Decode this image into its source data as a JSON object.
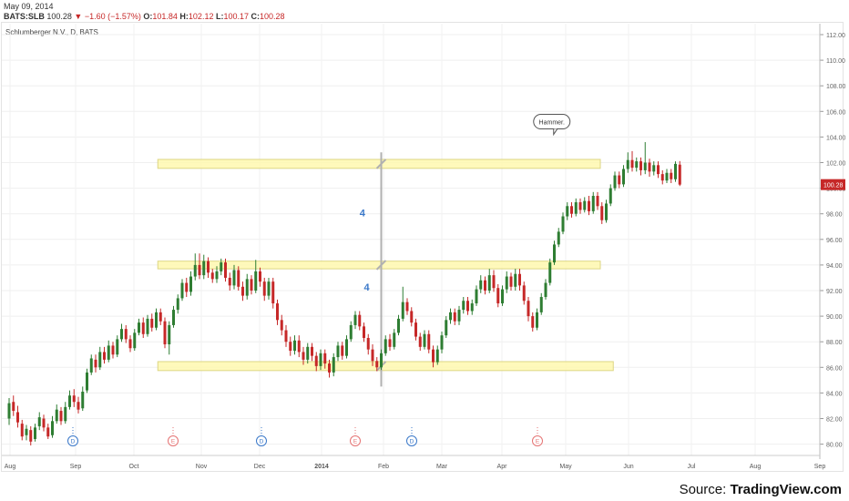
{
  "header": {
    "date": "May 09, 2014",
    "symbol": "BATS:SLB",
    "last": "100.28",
    "change": "▼ −1.60 (−1.57%)",
    "open_label": "O:",
    "open": "101.84",
    "high_label": "H:",
    "high": "102.12",
    "low_label": "L:",
    "low": "100.17",
    "close_label": "C:",
    "close": "100.28"
  },
  "instrument": "Schlumberger N.V., D, BATS",
  "price_badge": "100.28",
  "source": {
    "prefix": "Source: ",
    "brand": "TradingView.com"
  },
  "colors": {
    "up": "#2e7d32",
    "down": "#c62828",
    "zone_fill": "#fff9b0",
    "zone_stroke": "#d8d070",
    "grey_line": "#b0b0b0",
    "badge": "#c62828",
    "annot": "#3a78c9"
  },
  "chart_data": {
    "type": "candlestick",
    "title": "Schlumberger N.V., D, BATS",
    "ylim": [
      79,
      112.5
    ],
    "y_ticks": [
      "80.00",
      "82.00",
      "84.00",
      "86.00",
      "88.00",
      "90.00",
      "92.00",
      "94.00",
      "96.00",
      "98.00",
      "100.00",
      "102.00",
      "104.00",
      "106.00",
      "108.00",
      "110.00",
      "112.00"
    ],
    "x_ticks": [
      "Aug",
      "Sep",
      "Oct",
      "Nov",
      "Dec",
      "2014",
      "Feb",
      "Mar",
      "Apr",
      "May",
      "Jun",
      "Jul",
      "Aug",
      "Sep"
    ],
    "grid": true,
    "bars": [
      {
        "o": 82,
        "c": 83.2,
        "h": 83.6,
        "l": 81.5
      },
      {
        "o": 83.3,
        "c": 82.6,
        "h": 83.8,
        "l": 82.2
      },
      {
        "o": 82.5,
        "c": 81.7,
        "h": 83.0,
        "l": 81.3
      },
      {
        "o": 81.6,
        "c": 80.6,
        "h": 81.9,
        "l": 80.3
      },
      {
        "o": 80.7,
        "c": 81.2,
        "h": 81.5,
        "l": 80.3
      },
      {
        "o": 81.1,
        "c": 80.2,
        "h": 81.4,
        "l": 79.9
      },
      {
        "o": 80.4,
        "c": 81.3,
        "h": 81.6,
        "l": 80.2
      },
      {
        "o": 81.4,
        "c": 82.1,
        "h": 82.5,
        "l": 81.1
      },
      {
        "o": 82.0,
        "c": 81.3,
        "h": 82.3,
        "l": 81.0
      },
      {
        "o": 81.3,
        "c": 80.6,
        "h": 81.6,
        "l": 80.4
      },
      {
        "o": 80.7,
        "c": 81.8,
        "h": 82.2,
        "l": 80.5
      },
      {
        "o": 81.8,
        "c": 82.7,
        "h": 83.1,
        "l": 81.6
      },
      {
        "o": 82.6,
        "c": 81.8,
        "h": 82.9,
        "l": 81.5
      },
      {
        "o": 81.8,
        "c": 82.9,
        "h": 83.3,
        "l": 81.6
      },
      {
        "o": 82.9,
        "c": 83.8,
        "h": 84.2,
        "l": 82.7
      },
      {
        "o": 83.8,
        "c": 83.3,
        "h": 84.3,
        "l": 82.9
      },
      {
        "o": 83.3,
        "c": 82.7,
        "h": 83.7,
        "l": 82.4
      },
      {
        "o": 82.8,
        "c": 84.1,
        "h": 84.5,
        "l": 82.6
      },
      {
        "o": 84.2,
        "c": 85.6,
        "h": 85.9,
        "l": 84.0
      },
      {
        "o": 85.6,
        "c": 86.7,
        "h": 87.0,
        "l": 85.4
      },
      {
        "o": 86.6,
        "c": 86.0,
        "h": 87.0,
        "l": 85.6
      },
      {
        "o": 86.0,
        "c": 87.2,
        "h": 87.6,
        "l": 85.8
      },
      {
        "o": 87.2,
        "c": 86.6,
        "h": 87.6,
        "l": 86.3
      },
      {
        "o": 86.6,
        "c": 87.7,
        "h": 88.1,
        "l": 86.4
      },
      {
        "o": 87.7,
        "c": 87.0,
        "h": 88.0,
        "l": 86.7
      },
      {
        "o": 87.0,
        "c": 88.2,
        "h": 88.5,
        "l": 86.8
      },
      {
        "o": 88.2,
        "c": 89.0,
        "h": 89.4,
        "l": 88.0
      },
      {
        "o": 89.0,
        "c": 88.2,
        "h": 89.3,
        "l": 87.9
      },
      {
        "o": 88.2,
        "c": 87.5,
        "h": 88.5,
        "l": 87.2
      },
      {
        "o": 87.5,
        "c": 88.7,
        "h": 89.0,
        "l": 87.3
      },
      {
        "o": 88.7,
        "c": 89.5,
        "h": 89.8,
        "l": 88.5
      },
      {
        "o": 89.5,
        "c": 88.6,
        "h": 89.9,
        "l": 88.3
      },
      {
        "o": 88.6,
        "c": 89.8,
        "h": 90.1,
        "l": 88.4
      },
      {
        "o": 89.8,
        "c": 89.1,
        "h": 90.2,
        "l": 88.8
      },
      {
        "o": 89.1,
        "c": 90.3,
        "h": 90.6,
        "l": 88.9
      },
      {
        "o": 90.3,
        "c": 89.6,
        "h": 90.6,
        "l": 89.3
      },
      {
        "o": 89.6,
        "c": 87.8,
        "h": 89.9,
        "l": 87.5
      },
      {
        "o": 87.8,
        "c": 89.3,
        "h": 89.6,
        "l": 87.0
      },
      {
        "o": 89.3,
        "c": 90.5,
        "h": 90.8,
        "l": 89.1
      },
      {
        "o": 90.5,
        "c": 91.4,
        "h": 91.7,
        "l": 90.2
      },
      {
        "o": 91.4,
        "c": 92.6,
        "h": 92.9,
        "l": 91.2
      },
      {
        "o": 92.6,
        "c": 91.9,
        "h": 93.0,
        "l": 91.5
      },
      {
        "o": 91.9,
        "c": 93.1,
        "h": 93.5,
        "l": 91.6
      },
      {
        "o": 93.1,
        "c": 94.0,
        "h": 94.9,
        "l": 92.8
      },
      {
        "o": 94.0,
        "c": 93.2,
        "h": 94.9,
        "l": 92.9
      },
      {
        "o": 93.2,
        "c": 94.3,
        "h": 94.8,
        "l": 92.9
      },
      {
        "o": 94.3,
        "c": 93.4,
        "h": 94.6,
        "l": 93.0
      },
      {
        "o": 93.4,
        "c": 92.9,
        "h": 93.7,
        "l": 92.6
      },
      {
        "o": 92.9,
        "c": 93.5,
        "h": 93.9,
        "l": 92.6
      },
      {
        "o": 93.5,
        "c": 94.2,
        "h": 94.5,
        "l": 93.2
      },
      {
        "o": 94.2,
        "c": 93.0,
        "h": 94.5,
        "l": 92.7
      },
      {
        "o": 93.0,
        "c": 92.4,
        "h": 93.4,
        "l": 92.0
      },
      {
        "o": 92.4,
        "c": 93.6,
        "h": 94.0,
        "l": 92.1
      },
      {
        "o": 93.6,
        "c": 92.3,
        "h": 93.9,
        "l": 92.0
      },
      {
        "o": 92.3,
        "c": 91.6,
        "h": 92.7,
        "l": 91.2
      },
      {
        "o": 91.6,
        "c": 92.9,
        "h": 93.3,
        "l": 91.3
      },
      {
        "o": 92.9,
        "c": 92.0,
        "h": 93.2,
        "l": 91.7
      },
      {
        "o": 92.0,
        "c": 93.5,
        "h": 94.4,
        "l": 91.8
      },
      {
        "o": 93.5,
        "c": 92.7,
        "h": 93.8,
        "l": 92.3
      },
      {
        "o": 92.7,
        "c": 91.6,
        "h": 93.0,
        "l": 91.2
      },
      {
        "o": 91.6,
        "c": 92.7,
        "h": 93.0,
        "l": 91.3
      },
      {
        "o": 92.7,
        "c": 91.0,
        "h": 93.0,
        "l": 90.6
      },
      {
        "o": 91.0,
        "c": 89.7,
        "h": 91.3,
        "l": 89.3
      },
      {
        "o": 89.7,
        "c": 88.9,
        "h": 90.1,
        "l": 88.5
      },
      {
        "o": 88.9,
        "c": 88.0,
        "h": 89.3,
        "l": 87.6
      },
      {
        "o": 88.0,
        "c": 87.3,
        "h": 88.4,
        "l": 86.9
      },
      {
        "o": 87.3,
        "c": 88.1,
        "h": 88.5,
        "l": 87.0
      },
      {
        "o": 88.1,
        "c": 87.2,
        "h": 88.5,
        "l": 86.8
      },
      {
        "o": 87.2,
        "c": 86.6,
        "h": 87.6,
        "l": 86.2
      },
      {
        "o": 86.6,
        "c": 87.6,
        "h": 87.9,
        "l": 86.3
      },
      {
        "o": 87.6,
        "c": 86.9,
        "h": 87.9,
        "l": 86.5
      },
      {
        "o": 86.9,
        "c": 86.1,
        "h": 87.2,
        "l": 85.7
      },
      {
        "o": 86.1,
        "c": 87.1,
        "h": 87.4,
        "l": 85.8
      },
      {
        "o": 87.1,
        "c": 86.3,
        "h": 87.4,
        "l": 85.9
      },
      {
        "o": 86.3,
        "c": 85.6,
        "h": 86.6,
        "l": 85.2
      },
      {
        "o": 85.6,
        "c": 86.8,
        "h": 87.1,
        "l": 85.3
      },
      {
        "o": 86.8,
        "c": 87.7,
        "h": 88.0,
        "l": 86.5
      },
      {
        "o": 87.7,
        "c": 86.9,
        "h": 88.0,
        "l": 86.6
      },
      {
        "o": 86.9,
        "c": 88.2,
        "h": 88.5,
        "l": 86.7
      },
      {
        "o": 88.2,
        "c": 89.3,
        "h": 89.6,
        "l": 88.0
      },
      {
        "o": 89.3,
        "c": 90.1,
        "h": 90.4,
        "l": 89.0
      },
      {
        "o": 90.1,
        "c": 89.2,
        "h": 90.4,
        "l": 88.9
      },
      {
        "o": 89.2,
        "c": 88.3,
        "h": 89.5,
        "l": 88.0
      },
      {
        "o": 88.3,
        "c": 87.4,
        "h": 88.6,
        "l": 87.0
      },
      {
        "o": 87.4,
        "c": 86.5,
        "h": 87.8,
        "l": 86.1
      },
      {
        "o": 86.5,
        "c": 86.0,
        "h": 86.8,
        "l": 85.7
      },
      {
        "o": 86.0,
        "c": 87.1,
        "h": 87.4,
        "l": 85.8
      },
      {
        "o": 87.1,
        "c": 88.2,
        "h": 88.5,
        "l": 86.9
      },
      {
        "o": 88.2,
        "c": 87.6,
        "h": 88.6,
        "l": 87.3
      },
      {
        "o": 87.6,
        "c": 88.7,
        "h": 89.0,
        "l": 87.4
      },
      {
        "o": 88.7,
        "c": 89.8,
        "h": 90.1,
        "l": 88.5
      },
      {
        "o": 89.8,
        "c": 91.1,
        "h": 92.3,
        "l": 89.6
      },
      {
        "o": 91.1,
        "c": 90.4,
        "h": 91.4,
        "l": 90.1
      },
      {
        "o": 90.4,
        "c": 89.5,
        "h": 90.7,
        "l": 89.2
      },
      {
        "o": 89.5,
        "c": 88.4,
        "h": 89.8,
        "l": 88.1
      },
      {
        "o": 88.4,
        "c": 87.6,
        "h": 88.7,
        "l": 87.3
      },
      {
        "o": 87.6,
        "c": 88.6,
        "h": 88.9,
        "l": 87.4
      },
      {
        "o": 88.6,
        "c": 87.4,
        "h": 88.9,
        "l": 87.1
      },
      {
        "o": 87.4,
        "c": 86.4,
        "h": 87.7,
        "l": 86.0
      },
      {
        "o": 86.4,
        "c": 87.4,
        "h": 87.7,
        "l": 86.2
      },
      {
        "o": 87.4,
        "c": 88.5,
        "h": 88.8,
        "l": 87.1
      },
      {
        "o": 88.5,
        "c": 89.7,
        "h": 90.0,
        "l": 88.3
      },
      {
        "o": 89.7,
        "c": 90.3,
        "h": 90.6,
        "l": 89.4
      },
      {
        "o": 90.3,
        "c": 89.6,
        "h": 90.6,
        "l": 89.3
      },
      {
        "o": 89.6,
        "c": 90.5,
        "h": 90.8,
        "l": 89.3
      },
      {
        "o": 90.5,
        "c": 91.2,
        "h": 91.5,
        "l": 90.2
      },
      {
        "o": 91.2,
        "c": 90.4,
        "h": 91.5,
        "l": 90.1
      },
      {
        "o": 90.4,
        "c": 91.0,
        "h": 91.3,
        "l": 90.1
      },
      {
        "o": 91.0,
        "c": 92.1,
        "h": 92.4,
        "l": 90.8
      },
      {
        "o": 92.1,
        "c": 92.8,
        "h": 93.2,
        "l": 91.8
      },
      {
        "o": 92.8,
        "c": 92.0,
        "h": 93.1,
        "l": 91.7
      },
      {
        "o": 92.0,
        "c": 93.2,
        "h": 93.7,
        "l": 91.8
      },
      {
        "o": 93.2,
        "c": 92.2,
        "h": 93.6,
        "l": 91.9
      },
      {
        "o": 92.2,
        "c": 91.0,
        "h": 92.5,
        "l": 90.7
      },
      {
        "o": 91.0,
        "c": 92.1,
        "h": 92.4,
        "l": 90.8
      },
      {
        "o": 92.1,
        "c": 93.1,
        "h": 93.5,
        "l": 91.8
      },
      {
        "o": 93.1,
        "c": 92.3,
        "h": 93.4,
        "l": 92.0
      },
      {
        "o": 92.3,
        "c": 93.3,
        "h": 93.7,
        "l": 92.0
      },
      {
        "o": 93.3,
        "c": 92.4,
        "h": 93.7,
        "l": 92.0
      },
      {
        "o": 92.4,
        "c": 91.2,
        "h": 92.7,
        "l": 90.9
      },
      {
        "o": 91.2,
        "c": 90.0,
        "h": 91.5,
        "l": 89.6
      },
      {
        "o": 90.0,
        "c": 89.1,
        "h": 90.3,
        "l": 88.8
      },
      {
        "o": 89.1,
        "c": 90.3,
        "h": 90.6,
        "l": 88.9
      },
      {
        "o": 90.3,
        "c": 91.5,
        "h": 91.8,
        "l": 90.1
      },
      {
        "o": 91.5,
        "c": 92.6,
        "h": 92.9,
        "l": 91.3
      },
      {
        "o": 92.6,
        "c": 94.2,
        "h": 94.5,
        "l": 92.4
      },
      {
        "o": 94.2,
        "c": 95.6,
        "h": 95.9,
        "l": 94.0
      },
      {
        "o": 95.6,
        "c": 96.6,
        "h": 96.9,
        "l": 95.4
      },
      {
        "o": 96.6,
        "c": 97.8,
        "h": 98.1,
        "l": 96.4
      },
      {
        "o": 97.8,
        "c": 98.6,
        "h": 98.9,
        "l": 97.5
      },
      {
        "o": 98.6,
        "c": 98.0,
        "h": 98.9,
        "l": 97.7
      },
      {
        "o": 98.0,
        "c": 98.9,
        "h": 99.2,
        "l": 97.8
      },
      {
        "o": 98.9,
        "c": 98.3,
        "h": 99.2,
        "l": 98.0
      },
      {
        "o": 98.3,
        "c": 99.0,
        "h": 99.3,
        "l": 98.1
      },
      {
        "o": 99.0,
        "c": 98.2,
        "h": 99.4,
        "l": 97.9
      },
      {
        "o": 98.2,
        "c": 99.4,
        "h": 99.7,
        "l": 98.0
      },
      {
        "o": 99.4,
        "c": 98.6,
        "h": 99.7,
        "l": 98.3
      },
      {
        "o": 98.6,
        "c": 97.5,
        "h": 98.9,
        "l": 97.2
      },
      {
        "o": 97.5,
        "c": 98.8,
        "h": 99.1,
        "l": 97.3
      },
      {
        "o": 98.8,
        "c": 100.0,
        "h": 100.3,
        "l": 98.6
      },
      {
        "o": 100.0,
        "c": 101.0,
        "h": 101.3,
        "l": 99.8
      },
      {
        "o": 101.0,
        "c": 100.3,
        "h": 101.3,
        "l": 100.0
      },
      {
        "o": 100.3,
        "c": 101.5,
        "h": 101.8,
        "l": 100.1
      },
      {
        "o": 101.5,
        "c": 102.2,
        "h": 102.8,
        "l": 101.2
      },
      {
        "o": 102.2,
        "c": 101.6,
        "h": 102.9,
        "l": 101.3
      },
      {
        "o": 101.6,
        "c": 102.1,
        "h": 102.4,
        "l": 101.3
      },
      {
        "o": 102.1,
        "c": 101.4,
        "h": 102.4,
        "l": 101.0
      },
      {
        "o": 101.4,
        "c": 102.0,
        "h": 103.6,
        "l": 101.1
      },
      {
        "o": 102.0,
        "c": 101.3,
        "h": 102.3,
        "l": 100.9
      },
      {
        "o": 101.3,
        "c": 101.8,
        "h": 102.1,
        "l": 101.0
      },
      {
        "o": 101.8,
        "c": 101.1,
        "h": 102.1,
        "l": 100.8
      },
      {
        "o": 101.1,
        "c": 100.6,
        "h": 101.4,
        "l": 100.3
      },
      {
        "o": 100.6,
        "c": 101.2,
        "h": 101.5,
        "l": 100.4
      },
      {
        "o": 101.2,
        "c": 100.7,
        "h": 101.5,
        "l": 100.4
      },
      {
        "o": 100.7,
        "c": 101.9,
        "h": 102.1,
        "l": 100.5
      },
      {
        "o": 101.84,
        "c": 100.28,
        "h": 102.12,
        "l": 100.17
      }
    ],
    "bar_x_start": 10,
    "bar_x_step": 4.75,
    "zones": [
      {
        "y_low": 101.55,
        "y_high": 102.25,
        "x_from_bar": 35,
        "x_to_bar": 136
      },
      {
        "y_low": 93.7,
        "y_high": 94.3,
        "x_from_bar": 35,
        "x_to_bar": 136
      },
      {
        "y_low": 85.75,
        "y_high": 86.45,
        "x_from_bar": 35,
        "x_to_bar": 139
      }
    ],
    "annotations": [
      {
        "text": "4",
        "x_bar": 81,
        "y": 97.8
      },
      {
        "text": "4",
        "x_bar": 82,
        "y": 92.0
      },
      {
        "text": "Hammer.",
        "x_bar": 125,
        "y": 105.2
      }
    ],
    "events": [
      {
        "label": "D",
        "type": "dividend"
      },
      {
        "label": "E",
        "type": "earnings"
      },
      {
        "label": "D",
        "type": "dividend"
      },
      {
        "label": "E",
        "type": "earnings"
      },
      {
        "label": "D",
        "type": "dividend"
      },
      {
        "label": "E",
        "type": "earnings"
      }
    ]
  }
}
